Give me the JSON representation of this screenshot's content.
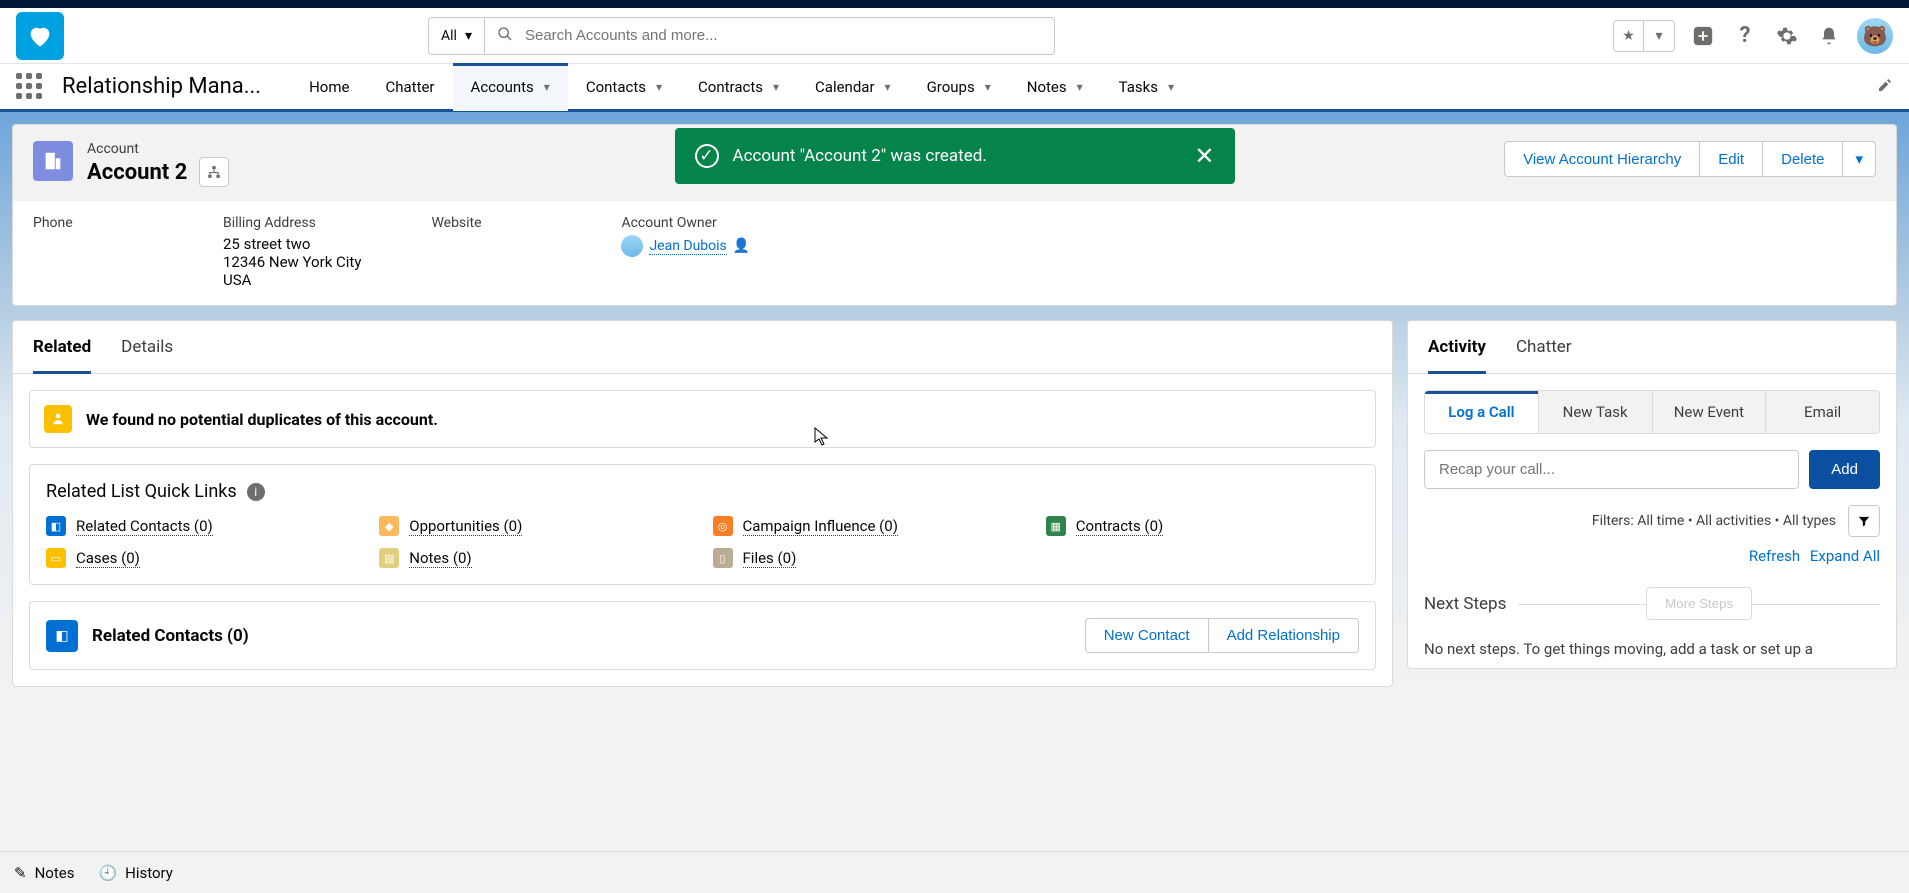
{
  "header": {
    "search_scope": "All",
    "search_placeholder": "Search Accounts and more..."
  },
  "nav": {
    "app_name": "Relationship Mana...",
    "tabs": [
      "Home",
      "Chatter",
      "Accounts",
      "Contacts",
      "Contracts",
      "Calendar",
      "Groups",
      "Notes",
      "Tasks"
    ],
    "active": "Accounts"
  },
  "toast": {
    "message": "Account \"Account 2\" was created."
  },
  "record": {
    "type": "Account",
    "name": "Account 2",
    "actions": {
      "view_hierarchy": "View Account Hierarchy",
      "edit": "Edit",
      "delete": "Delete"
    },
    "fields": {
      "phone_label": "Phone",
      "billing_label": "Billing Address",
      "billing_line1": "25 street two",
      "billing_line2": "12346 New York City",
      "billing_line3": "USA",
      "website_label": "Website",
      "owner_label": "Account Owner",
      "owner_name": "Jean Dubois"
    }
  },
  "left_tabs": {
    "related": "Related",
    "details": "Details"
  },
  "duplicates": {
    "text": "We found no potential duplicates of this account."
  },
  "quick_links": {
    "title": "Related List Quick Links",
    "items": [
      {
        "label": "Related Contacts (0)",
        "color": "#0070d2"
      },
      {
        "label": "Opportunities (0)",
        "color": "#fcb95b"
      },
      {
        "label": "Campaign Influence (0)",
        "color": "#f67e26"
      },
      {
        "label": "Contracts (0)",
        "color": "#2e844a"
      },
      {
        "label": "Cases (0)",
        "color": "#fcc003"
      },
      {
        "label": "Notes (0)",
        "color": "#e3ce7d"
      },
      {
        "label": "Files (0)",
        "color": "#baac93"
      }
    ]
  },
  "related_contacts": {
    "title": "Related Contacts (0)",
    "new_contact": "New Contact",
    "add_rel": "Add Relationship"
  },
  "right_tabs": {
    "activity": "Activity",
    "chatter": "Chatter"
  },
  "activity": {
    "tabs": [
      "Log a Call",
      "New Task",
      "New Event",
      "Email"
    ],
    "recap_placeholder": "Recap your call...",
    "add": "Add",
    "filters": "Filters: All time • All activities • All types",
    "refresh": "Refresh",
    "expand": "Expand All",
    "next_steps": "Next Steps",
    "more_steps": "More Steps",
    "next_text": "No next steps. To get things moving, add a task or set up a"
  },
  "footer": {
    "notes": "Notes",
    "history": "History"
  }
}
